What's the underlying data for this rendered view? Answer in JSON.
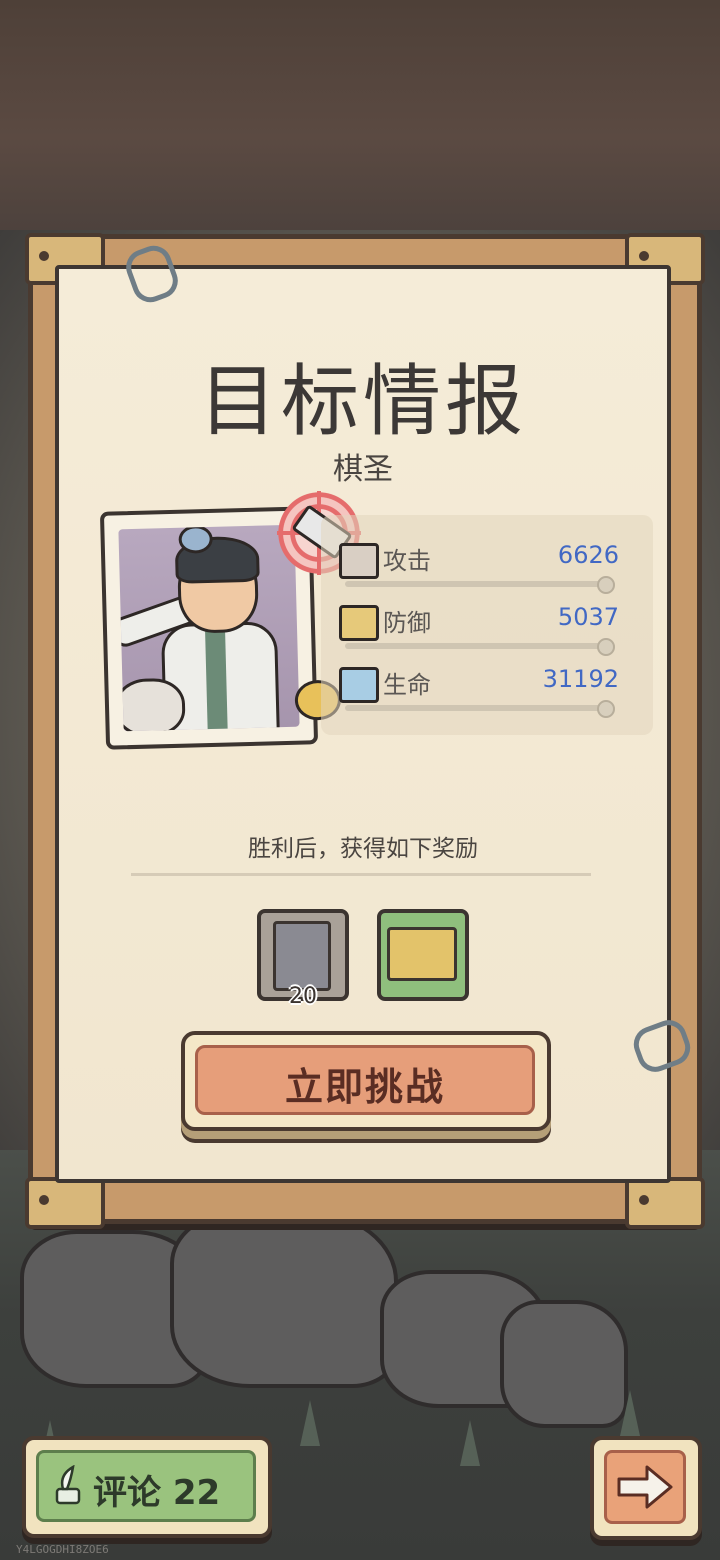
{
  "panel": {
    "title": "目标情报",
    "target_name": "棋圣"
  },
  "stats": [
    {
      "label": "攻击",
      "value": "6626",
      "icon": "attack-icon"
    },
    {
      "label": "防御",
      "value": "5037",
      "icon": "defense-icon"
    },
    {
      "label": "生命",
      "value": "31192",
      "icon": "health-icon"
    }
  ],
  "rewards": {
    "caption": "胜利后，获得如下奖励",
    "items": [
      {
        "icon": "badge-icon",
        "count": "20"
      },
      {
        "icon": "card-icon",
        "count": ""
      }
    ]
  },
  "challenge_button": {
    "label": "立即挑战"
  },
  "comment_button": {
    "label": "评论 22"
  },
  "footer": {
    "id_text": "Y4LGOGDHI8ZOE6"
  },
  "colors": {
    "stat_value": "#4168c4",
    "challenge": "#e69e7a",
    "comment": "#9ac37e"
  }
}
